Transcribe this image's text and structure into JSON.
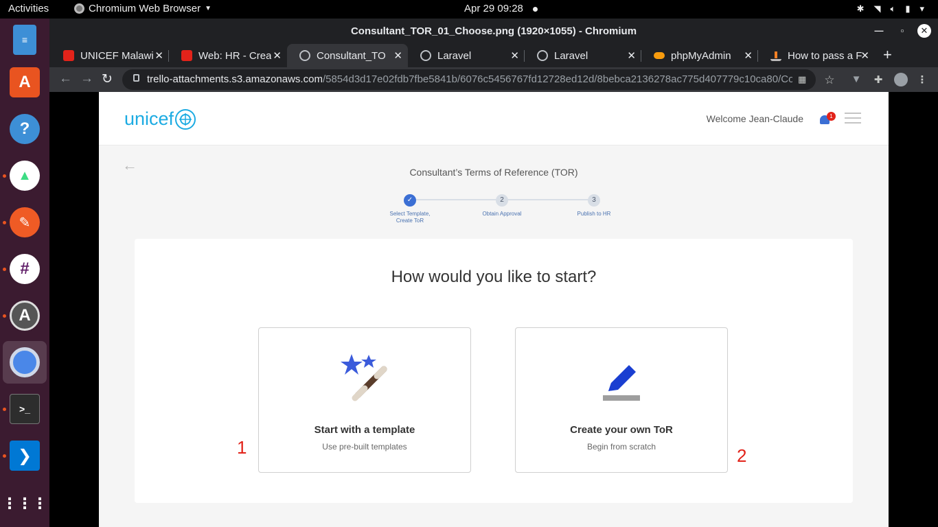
{
  "topbar": {
    "activities": "Activities",
    "app_name": "Chromium Web Browser",
    "datetime": "Apr 29  09:28"
  },
  "dock": {
    "items": [
      "text-editor",
      "ubuntu-software",
      "help",
      "android-studio",
      "postman",
      "slack",
      "software-updater",
      "chromium",
      "terminal",
      "vs-code",
      "show-applications"
    ]
  },
  "window": {
    "title": "Consultant_TOR_01_Choose.png (1920×1055) - Chromium"
  },
  "tabs": [
    {
      "label": "UNICEF Malawi",
      "favicon": "trello",
      "color": "#e2231a"
    },
    {
      "label": "Web: HR - Creat",
      "favicon": "trello",
      "color": "#e2231a"
    },
    {
      "label": "Consultant_TO",
      "favicon": "globe",
      "color": "#9aa0a6"
    },
    {
      "label": "Laravel",
      "favicon": "globe",
      "color": "#9aa0a6"
    },
    {
      "label": "Laravel",
      "favicon": "globe",
      "color": "#9aa0a6"
    },
    {
      "label": "phpMyAdmin",
      "favicon": "phpmyadmin",
      "color": "#f89c0e"
    },
    {
      "label": "How to pass a F",
      "favicon": "stackoverflow",
      "color": "#f48024"
    }
  ],
  "toolbar": {
    "url_host": "trello-attachments.s3.amazonaws.com",
    "url_path": "/5854d3d17e02fdb7fbe5841b/6076c5456767fd12728ed12d/8bebca2136278ac775d407779c10ca80/Consul..."
  },
  "page": {
    "brand": "unicef",
    "welcome": "Welcome Jean-Claude",
    "notification_count": "1",
    "tor_title": "Consultant’s Terms of Reference (TOR)",
    "steps": [
      {
        "num": "✓",
        "label_line1": "Select Template,",
        "label_line2": "Create ToR",
        "done": true
      },
      {
        "num": "2",
        "label_line1": "Obtain Approval",
        "label_line2": "",
        "done": false
      },
      {
        "num": "3",
        "label_line1": "Publish to HR",
        "label_line2": "",
        "done": false
      }
    ],
    "question": "How would you like to start?",
    "options": [
      {
        "title": "Start with a template",
        "subtitle": "Use pre-built templates",
        "icon": "magic-wand-icon"
      },
      {
        "title": "Create your own ToR",
        "subtitle": "Begin from scratch",
        "icon": "pencil-icon"
      }
    ],
    "annotations": [
      "1",
      "2"
    ]
  },
  "colors": {
    "unicef_blue": "#1cabe2",
    "primary_blue": "#3b6fd4",
    "annotation_red": "#e2231a"
  }
}
